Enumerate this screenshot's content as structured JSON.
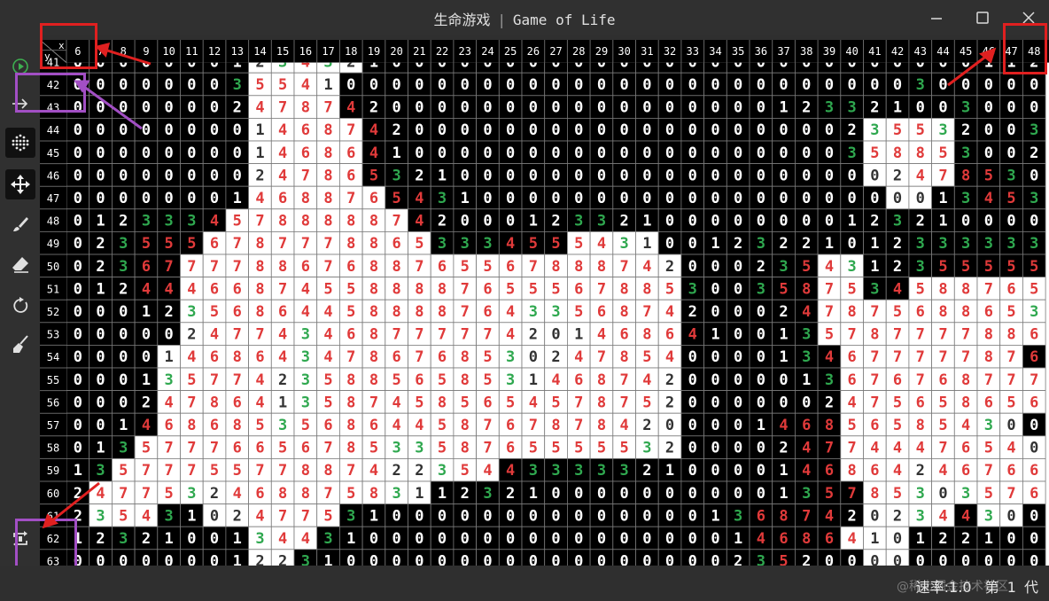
{
  "window": {
    "title_cn": "生命游戏",
    "title_sep": "|",
    "title_en": "Game of Life",
    "buttons": [
      "minimize",
      "maximize",
      "close"
    ]
  },
  "toolbar": {
    "tools": [
      {
        "name": "play-icon",
        "active": false
      },
      {
        "name": "step-icon",
        "active": false
      },
      {
        "name": "grid-icon",
        "active": true
      },
      {
        "name": "move-icon",
        "active": true
      },
      {
        "name": "brush-icon",
        "active": false
      },
      {
        "name": "eraser-icon",
        "active": false
      },
      {
        "name": "reset-icon",
        "active": false
      },
      {
        "name": "clear-icon",
        "active": false
      },
      {
        "name": "loop-icon",
        "active": false
      }
    ]
  },
  "grid": {
    "corner_x": "x",
    "corner_y": "y",
    "col_labels": [
      "6",
      "7",
      "8",
      "9",
      "10",
      "11",
      "12",
      "13",
      "14",
      "15",
      "16",
      "17",
      "18",
      "19",
      "20",
      "21",
      "22",
      "23",
      "24",
      "25",
      "26",
      "27",
      "28",
      "29",
      "30",
      "31",
      "32",
      "33",
      "34",
      "35",
      "36",
      "37",
      "38",
      "39",
      "40",
      "41",
      "42",
      "43",
      "44",
      "45",
      "46",
      "47",
      "48"
    ],
    "row_labels": [
      "41",
      "42",
      "43",
      "44",
      "45",
      "46",
      "47",
      "48",
      "49",
      "50",
      "51",
      "52",
      "53",
      "54",
      "55",
      "56",
      "57",
      "58",
      "59",
      "60",
      "61",
      "62",
      "63"
    ],
    "alive_char": "#",
    "cells": [
      "0000000123432100000000000000000000000000112",
      "0000000#3#55#4#100000000000000000000000003",
      "0000000#2#4#7#8#74200000000000000000123321003",
      "000000001#4#687420000000000000000000235532003",
      "000000001#4#686#410000000000000000000358853002",
      "000000002#4#786#5321000000000000000000024785300#1",
      "0000000#14#6887654#3100000000000000000000134532000",
      "012#33#34#57888887#4200012332100000000123210000",
      "0235556787778865#333#4555#43100123221012333333",
      "02367777886#76887655678887#420002354#312355555",
      "0124#44#6#68745588887655567885300358753458876#5",
      "0001235686#44#588887#64335687#4200024787#5#68865#3",
      "000002477#4#34687777742014686#410013578777788#6#53",
      "00001#46864#347867685#302478#54000013#4677777876#5",
      "0001#357742#358856585314687420000013#676#768777",
      "000247864135874585654578752000000247565865#6#4",
      "0014686853#5686#4458767878#4200001468565#85#43",
      "013#577766567853#358765555#5320000247744476#5#4",
      "13#577755778874#22354#4333332100001468642#4676#6",
      "2477#5324688758#31123210000000000135785#30#357#65",
      "23543#10#2477531000000000000001368742023#4#43",
      "123210013#44#31000000000000000014686#4101221#0",
      "0000000#12231000000000000000002352000000000"
    ],
    "alive": [
      "0000000011111000000000000000000000000000000",
      "0000000011110000000000000000000000000000000",
      "0000000011110000000000000000000000000000000",
      "0000000011111000000000000000000000011110000",
      "0000000011111000000000000000000000011110000",
      "0000000011111000000000000000000000011110000",
      "0000000011111100000000000000000000001100000",
      "0000000111111110000000000000000000000000000",
      "0000001111111111000000111100000000000000000",
      "0000011111111111111111111110000001100000000",
      "0000011111111111111111111110000001100111111",
      "0000011111111111111111111110000001111111111",
      "0000011111111111111111111110000001111111111",
      "0000111111111111111111111110000000111111110",
      "0000111111111111111111111110000000111111111",
      "0000111111111111111111111110000000111111111",
      "0000111111111111111111111110000000111111110",
      "0001111111111111111111111110000000111111111",
      "0011111111111111111000000000000000111111111",
      "0111111111111111000000000000000000011111111",
      "0111001111110000000000000000000000011110110",
      "0000000011100000000000000000000000111000000",
      "0000000011000000000000000000000000011000000"
    ]
  },
  "status": {
    "speed_label": "速率:",
    "speed_value": "1.0",
    "gen_label": "第",
    "gen_value": "1",
    "gen_suffix": "代",
    "watermark": "@稀土掘金技术社区"
  },
  "colors": {
    "dead_bg": "#000000",
    "alive_bg": "#ffffff",
    "zero_text": "#ffffff",
    "three_text": "#2fa84f",
    "high_text": "#e03a3a",
    "header_bg": "#000000",
    "header_text": "#ffffff",
    "annotation_red": "#e02020",
    "annotation_purple": "#a24fc4"
  }
}
